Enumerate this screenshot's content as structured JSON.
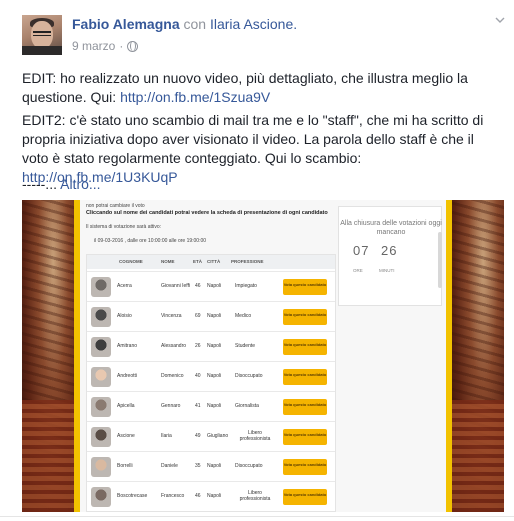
{
  "post": {
    "author": "Fabio Alemagna",
    "with_prefix": "con",
    "with_name": "Ilaria Ascione.",
    "date": "9 marzo",
    "dot": "·",
    "icons": {
      "privacy": "globe-icon",
      "options": "chevron-down-icon"
    },
    "paragraphs": [
      {
        "text": "EDIT: ho realizzato un nuovo video, più dettagliato, che illustra meglio la questione. Qui: ",
        "link": "http://on.fb.me/1Szua9V"
      },
      {
        "text": "EDIT2: c'è stato uno scambio di mail tra me e lo \"staff\", che mi ha scritto di propria iniziativa dopo aver visionato il video. La parola dello staff è che il voto è stato regolarmente conteggiato. Qui lo scambio: ",
        "link": "http://on.fb.me/1U3KUqP"
      }
    ],
    "ellipsis": "-----...",
    "more_label": "Altro..."
  },
  "screenshot": {
    "intro_line": "non potrai cambiare il voto",
    "instruction": "Cliccando sul nome dei candidati potrai vedere la scheda di presentazione di ogni candidato",
    "system_line": "Il sistema di votazione sarà attivo:",
    "schedule_line": "il 09-03-2016 , dalle ore 10:00:00 alle ore 19:00:00",
    "columns": [
      "COGNOME",
      "NOME",
      "ETÀ",
      "CITTÀ",
      "PROFESSIONE"
    ],
    "vote_label": "Vota questo candidato",
    "rows": [
      {
        "cognome": "Acerra",
        "nome": "Giovanni Ieffi",
        "eta": "46",
        "citta": "Napoli",
        "professione": "Impiegato",
        "photo_color": "#6f6a66"
      },
      {
        "cognome": "Aloisio",
        "nome": "Vincenza",
        "eta": "69",
        "citta": "Napoli",
        "professione": "Medico",
        "photo_color": "#4a4a4a"
      },
      {
        "cognome": "Amitrano",
        "nome": "Alessandro",
        "eta": "26",
        "citta": "Napoli",
        "professione": "Studente",
        "photo_color": "#3d3d3d"
      },
      {
        "cognome": "Andreotti",
        "nome": "Domenico",
        "eta": "40",
        "citta": "Napoli",
        "professione": "Disoccupato",
        "photo_color": "#e8c8b0"
      },
      {
        "cognome": "Apicella",
        "nome": "Gennaro",
        "eta": "41",
        "citta": "Napoli",
        "professione": "Giornalista",
        "photo_color": "#8a7a70"
      },
      {
        "cognome": "Ascione",
        "nome": "Ilaria",
        "eta": "49",
        "citta": "Giugliano",
        "professione": "Libero professionista",
        "photo_color": "#5a4d45"
      },
      {
        "cognome": "Borrelli",
        "nome": "Daniele",
        "eta": "35",
        "citta": "Napoli",
        "professione": "Disoccupato",
        "photo_color": "#d9b9a0"
      },
      {
        "cognome": "Boscotrecase",
        "nome": "Francesco",
        "eta": "46",
        "citta": "Napoli",
        "professione": "Libero professionista",
        "photo_color": "#7a6a62"
      }
    ],
    "timer": {
      "title": "Alla chiusura delle votazioni oggi mancano",
      "hours": "07",
      "minutes": "26",
      "hours_label": "ORE",
      "minutes_label": "MINUTI"
    }
  },
  "colors": {
    "link": "#365899",
    "meta": "#90949c",
    "accent_yellow": "#f2c200",
    "vote_button": "#f5b400"
  }
}
